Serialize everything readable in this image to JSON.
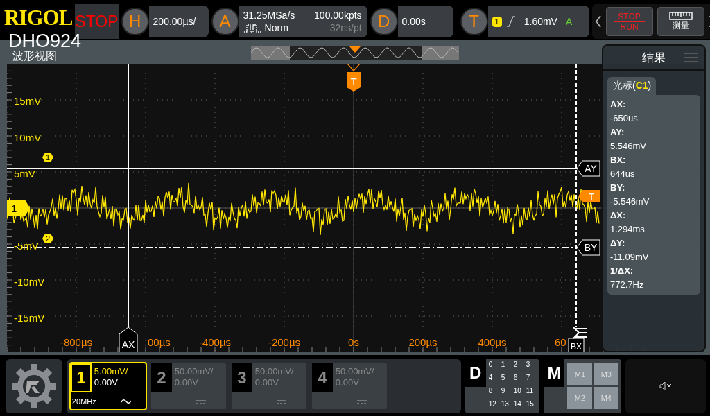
{
  "header": {
    "brand": "RIGOL",
    "model": "DHO924",
    "run_state": "STOP",
    "horizontal": {
      "key": "H",
      "scale": "200.00µs/"
    },
    "acquire": {
      "key": "A",
      "sample_rate": "31.25MSa/s",
      "memory_depth": "100.00kpts",
      "mode": "Norm",
      "interval": "32ns/pt"
    },
    "delay": {
      "key": "D",
      "offset": "0.00s"
    },
    "trigger": {
      "key": "T",
      "source": "1",
      "level": "1.60mV",
      "sweep": "A"
    },
    "run_stop": {
      "top": "STOP",
      "bottom": "RUN"
    },
    "measure_button": "测量"
  },
  "view": {
    "title": "波形视图",
    "y_labels": [
      "15mV",
      "10mV",
      "5mV",
      "-5mV",
      "-10mV",
      "-15mV"
    ],
    "x_labels": [
      "-800µs",
      "00µs",
      "-400µs",
      "-200µs",
      "0s",
      "200µs",
      "400µs",
      "60"
    ],
    "trigger_marker": "T",
    "trigger_level_marker": "T",
    "channel_marker": "1",
    "reference_markers": [
      "1",
      "2"
    ],
    "cursors": {
      "ax": "AX",
      "ay": "AY",
      "bx": "BX",
      "by": "BY"
    }
  },
  "results": {
    "title": "结果",
    "tab": {
      "prefix": "光标(",
      "channel": "C1",
      "suffix": ")"
    },
    "items": [
      {
        "label": "AX:",
        "value": "-650us"
      },
      {
        "label": "AY:",
        "value": "5.546mV"
      },
      {
        "label": "BX:",
        "value": "644us"
      },
      {
        "label": "BY:",
        "value": "-5.546mV"
      },
      {
        "label": "ΔX:",
        "value": "1.294ms"
      },
      {
        "label": "ΔY:",
        "value": "-11.09mV"
      },
      {
        "label": "1/ΔX:",
        "value": "772.7Hz"
      }
    ]
  },
  "channels": [
    {
      "number": "1",
      "scale": "5.00mV/",
      "offset": "0.00V",
      "bandwidth": "20MHz",
      "kind": "ac",
      "selected": true
    },
    {
      "number": "2",
      "scale": "50.00mV/",
      "offset": "0.00V",
      "kind": "dc",
      "selected": false
    },
    {
      "number": "3",
      "scale": "50.00mV/",
      "offset": "0.00V",
      "kind": "dc",
      "selected": false
    },
    {
      "number": "4",
      "scale": "50.00mV/",
      "offset": "0.00V",
      "kind": "dc",
      "selected": false
    }
  ],
  "digital": {
    "key": "D",
    "channels": [
      "0",
      "1",
      "2",
      "3",
      "4",
      "5",
      "6",
      "7",
      "8",
      "9",
      "10",
      "11",
      "12",
      "13",
      "14",
      "15"
    ]
  },
  "math": {
    "key": "M",
    "items": [
      "M1",
      "M3",
      "M2",
      "M4"
    ]
  }
}
